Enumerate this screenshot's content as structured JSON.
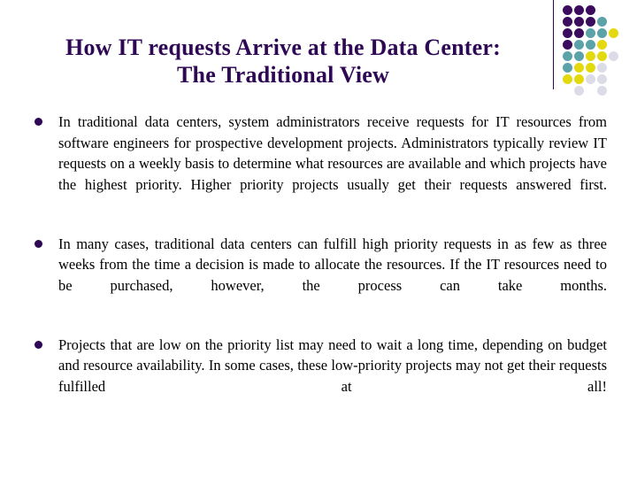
{
  "slide": {
    "title": {
      "line1": "How IT requests Arrive at the Data Center:",
      "line2": "The Traditional View",
      "color": "#2E0854"
    },
    "bullets": [
      {
        "marker": "round-bullet",
        "text": "In traditional data centers, system administrators receive requests for IT resources from software engineers for prospective development projects. Administrators typically review IT requests on a weekly basis to determine what resources are available and which projects have the highest priority. Higher priority projects usually get their requests answered first."
      },
      {
        "marker": "round-bullet",
        "text": "In many cases, traditional data centers can fulfill high priority requests in as few as three weeks from the time a decision is made to allocate the resources. If the IT resources need to be purchased, however, the process can take months."
      },
      {
        "marker": "round-bullet",
        "text": "Projects that are low on the priority list may need to wait a long time, depending on budget and resource availability. In some cases, these low-priority projects may not get their requests fulfilled at all!"
      }
    ],
    "decoration": {
      "name": "dot-grid-ornament",
      "divider_color": "#2E0854",
      "palette": {
        "purple": "#3B0B5E",
        "teal": "#5BA3A8",
        "yellow": "#E3D90F",
        "lavender": "#DCDCE8"
      },
      "rows": [
        [
          "purple",
          "purple",
          "purple"
        ],
        [
          "purple",
          "purple",
          "purple",
          "teal"
        ],
        [
          "purple",
          "purple",
          "teal",
          "teal",
          "yellow"
        ],
        [
          "purple",
          "teal",
          "teal",
          "yellow"
        ],
        [
          "teal",
          "teal",
          "yellow",
          "yellow",
          "lavender"
        ],
        [
          "teal",
          "yellow",
          "yellow",
          "lavender"
        ],
        [
          "yellow",
          "yellow",
          "lavender",
          "lavender"
        ],
        [
          "empty",
          "lavender",
          "empty",
          "lavender"
        ]
      ]
    }
  }
}
